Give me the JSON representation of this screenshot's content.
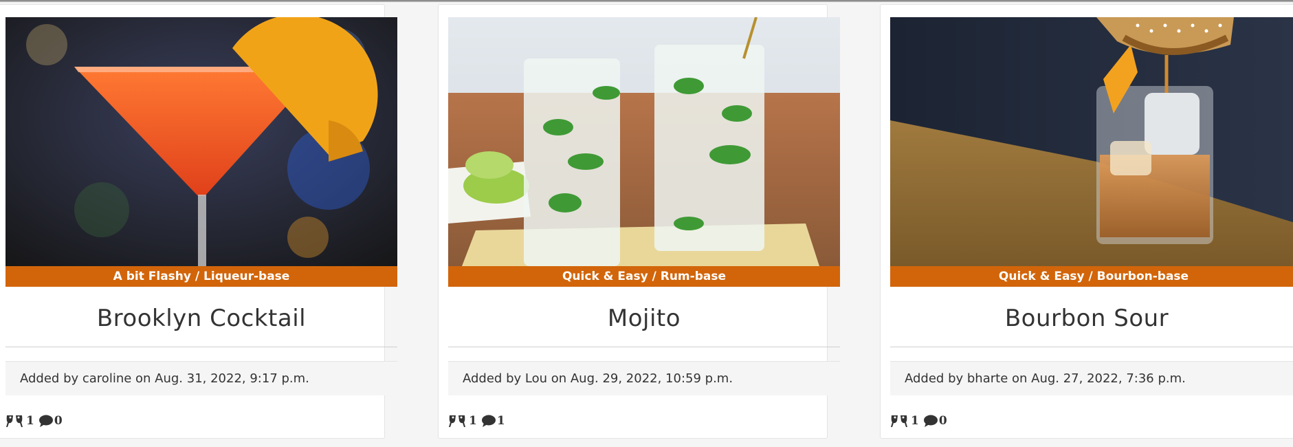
{
  "cards": [
    {
      "category": "A bit Flashy / Liqueur-base",
      "title": "Brooklyn Cocktail",
      "added_by": "Added by caroline on Aug. 31, 2022, 9:17 p.m.",
      "cheers_count": "1",
      "comments_count": "0"
    },
    {
      "category": "Quick & Easy / Rum-base",
      "title": "Mojito",
      "added_by": "Added by Lou on Aug. 29, 2022, 10:59 p.m.",
      "cheers_count": "1",
      "comments_count": "1"
    },
    {
      "category": "Quick & Easy / Bourbon-base",
      "title": "Bourbon Sour",
      "added_by": "Added by bharte on Aug. 27, 2022, 7:36 p.m.",
      "cheers_count": "1",
      "comments_count": "0"
    }
  ],
  "colors": {
    "category_band": "#d2650a",
    "card_background": "#ffffff",
    "page_background": "#f5f5f5",
    "added_box": "#f5f5f5"
  },
  "icons": {
    "cheers": "glasses-clink-icon",
    "comments": "comment-bubble-icon"
  }
}
